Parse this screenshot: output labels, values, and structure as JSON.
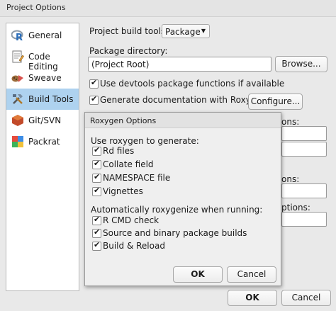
{
  "window": {
    "title": "Project Options"
  },
  "sidebar": {
    "items": [
      {
        "label": "General",
        "icon": "r-logo-icon",
        "selected": false
      },
      {
        "label": "Code Editing",
        "icon": "code-editing-icon",
        "selected": false
      },
      {
        "label": "Sweave",
        "icon": "sweave-icon",
        "selected": false
      },
      {
        "label": "Build Tools",
        "icon": "build-tools-icon",
        "selected": true
      },
      {
        "label": "Git/SVN",
        "icon": "git-svn-icon",
        "selected": false
      },
      {
        "label": "Packrat",
        "icon": "packrat-icon",
        "selected": false
      }
    ]
  },
  "main": {
    "build_tools_label": "Project build tools:",
    "build_tools_value": "Package",
    "package_dir_label": "Package directory:",
    "package_dir_value": "(Project Root)",
    "browse_label": "Browse...",
    "devtools_label": "Use devtools package functions if available",
    "devtools_checked": true,
    "roxygen_label": "Generate documentation with Roxygen",
    "roxygen_checked": true,
    "configure_label": "Configure...",
    "hidden_stub_1": "ons:",
    "hidden_stub_2": "ons:",
    "hidden_stub_3": "ptions:"
  },
  "dialog": {
    "title": "Roxygen Options",
    "use_label": "Use roxygen to generate:",
    "use_items": [
      {
        "label": "Rd files",
        "checked": true
      },
      {
        "label": "Collate field",
        "checked": true
      },
      {
        "label": "NAMESPACE file",
        "checked": true
      },
      {
        "label": "Vignettes",
        "checked": true
      }
    ],
    "auto_label": "Automatically roxygenize when running:",
    "auto_items": [
      {
        "label": "R CMD check",
        "checked": true
      },
      {
        "label": "Source and binary package builds",
        "checked": true
      },
      {
        "label": "Build & Reload",
        "checked": true
      }
    ],
    "ok_label": "OK",
    "cancel_label": "Cancel"
  },
  "footer": {
    "ok_label": "OK",
    "cancel_label": "Cancel"
  },
  "colors": {
    "selection": "#aed2ef",
    "background": "#e9e9e9",
    "r_blue": "#2a6ebb"
  }
}
